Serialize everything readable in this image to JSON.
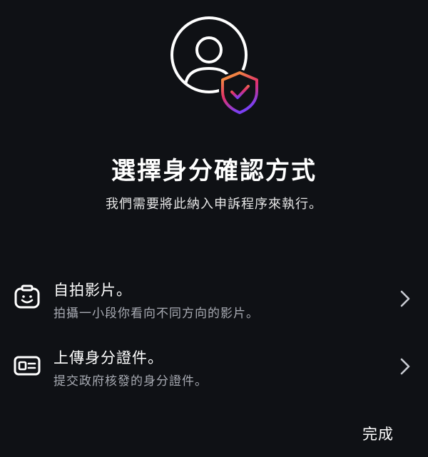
{
  "header": {
    "hero_icon": "user-with-verified-shield-icon",
    "title": "選擇身分確認方式",
    "subtitle": "我們需要將此納入申訴程序來執行。"
  },
  "options": [
    {
      "icon": "selfie-camera-icon",
      "title": "自拍影片。",
      "description": "拍攝一小段你看向不同方向的影片。"
    },
    {
      "icon": "id-card-icon",
      "title": "上傳身分證件。",
      "description": "提交政府核發的身分證件。"
    }
  ],
  "footer": {
    "done_label": "完成"
  },
  "colors": {
    "background": "#0f1115",
    "text_primary": "#ffffff",
    "text_secondary": "#a8abb3",
    "shield_gradient": [
      "#f7a531",
      "#e1306c",
      "#7b3ff2"
    ]
  }
}
